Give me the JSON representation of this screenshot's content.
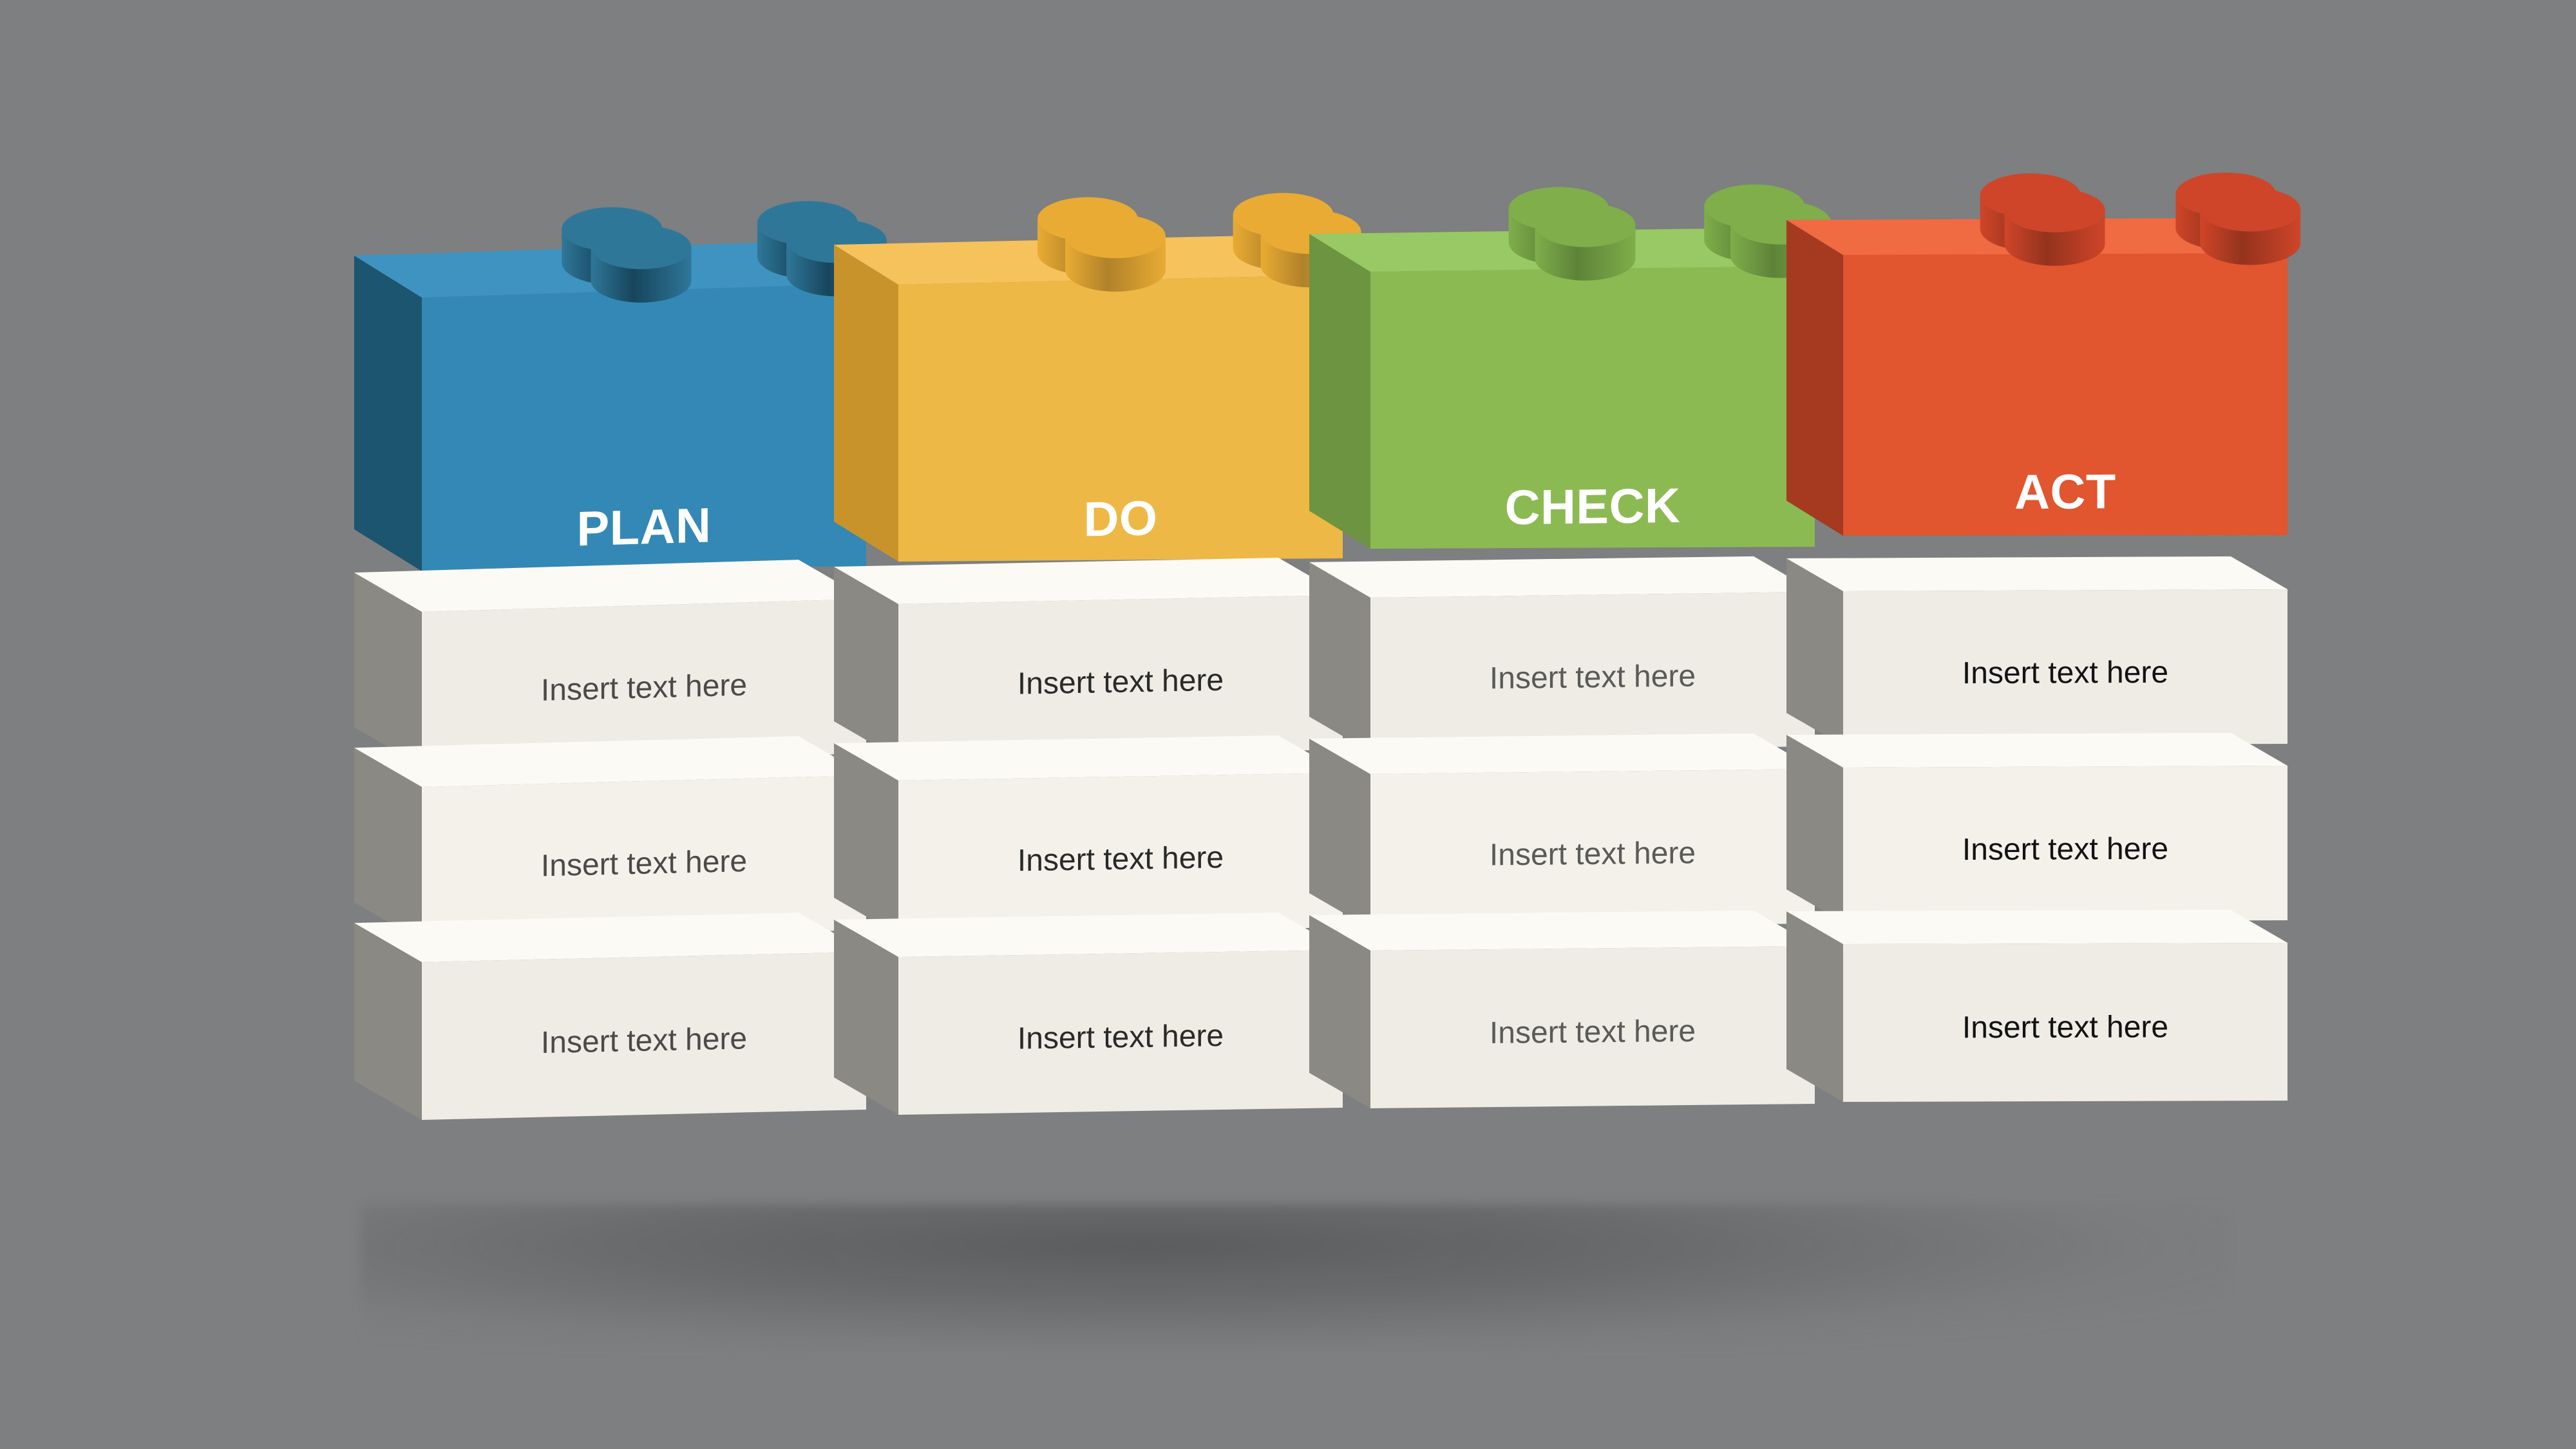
{
  "background_color": "#7d7f80",
  "diagram": {
    "type": "pdca-lego-blocks",
    "columns": [
      {
        "id": "plan",
        "brick_label": "PLAN",
        "colors": {
          "top": "#3e93c0",
          "front": "#3488b5",
          "side": "#1c5570",
          "stud_top": "#2f7799",
          "stud_side": "#17455c",
          "label": "#ffffff"
        },
        "blocks": [
          {
            "text": "Insert text here",
            "text_color": "#4a4a48"
          },
          {
            "text": "Insert text here",
            "text_color": "#4a4a48"
          },
          {
            "text": "Insert text here",
            "text_color": "#4a4a48"
          }
        ]
      },
      {
        "id": "do",
        "brick_label": "DO",
        "colors": {
          "top": "#f6c25c",
          "front": "#edb845",
          "side": "#c9932c",
          "stud_top": "#e9ab33",
          "stud_side": "#b1822a",
          "label": "#ffffff"
        },
        "blocks": [
          {
            "text": "Insert text here",
            "text_color": "#2a2a28"
          },
          {
            "text": "Insert text here",
            "text_color": "#2a2a28"
          },
          {
            "text": "Insert text here",
            "text_color": "#2a2a28"
          }
        ]
      },
      {
        "id": "check",
        "brick_label": "CHECK",
        "colors": {
          "top": "#98c964",
          "front": "#8cba52",
          "side": "#6d9440",
          "stud_top": "#7fae4b",
          "stud_side": "#5e8338",
          "label": "#ffffff"
        },
        "blocks": [
          {
            "text": "Insert text here",
            "text_color": "#5a5a58"
          },
          {
            "text": "Insert text here",
            "text_color": "#5a5a58"
          },
          {
            "text": "Insert text here",
            "text_color": "#5a5a58"
          }
        ]
      },
      {
        "id": "act",
        "brick_label": "ACT",
        "colors": {
          "top": "#f06a42",
          "front": "#e1552f",
          "side": "#a63a20",
          "stud_top": "#cf4529",
          "stud_side": "#94331d",
          "label": "#ffffff"
        },
        "blocks": [
          {
            "text": "Insert text here",
            "text_color": "#121212"
          },
          {
            "text": "Insert text here",
            "text_color": "#121212"
          },
          {
            "text": "Insert text here",
            "text_color": "#121212"
          }
        ]
      }
    ],
    "block_colors": {
      "face": "#eeece5",
      "face_alt": "#f3f1ea",
      "top_edge": "#fbfaf4",
      "side": "#8b8984"
    }
  }
}
